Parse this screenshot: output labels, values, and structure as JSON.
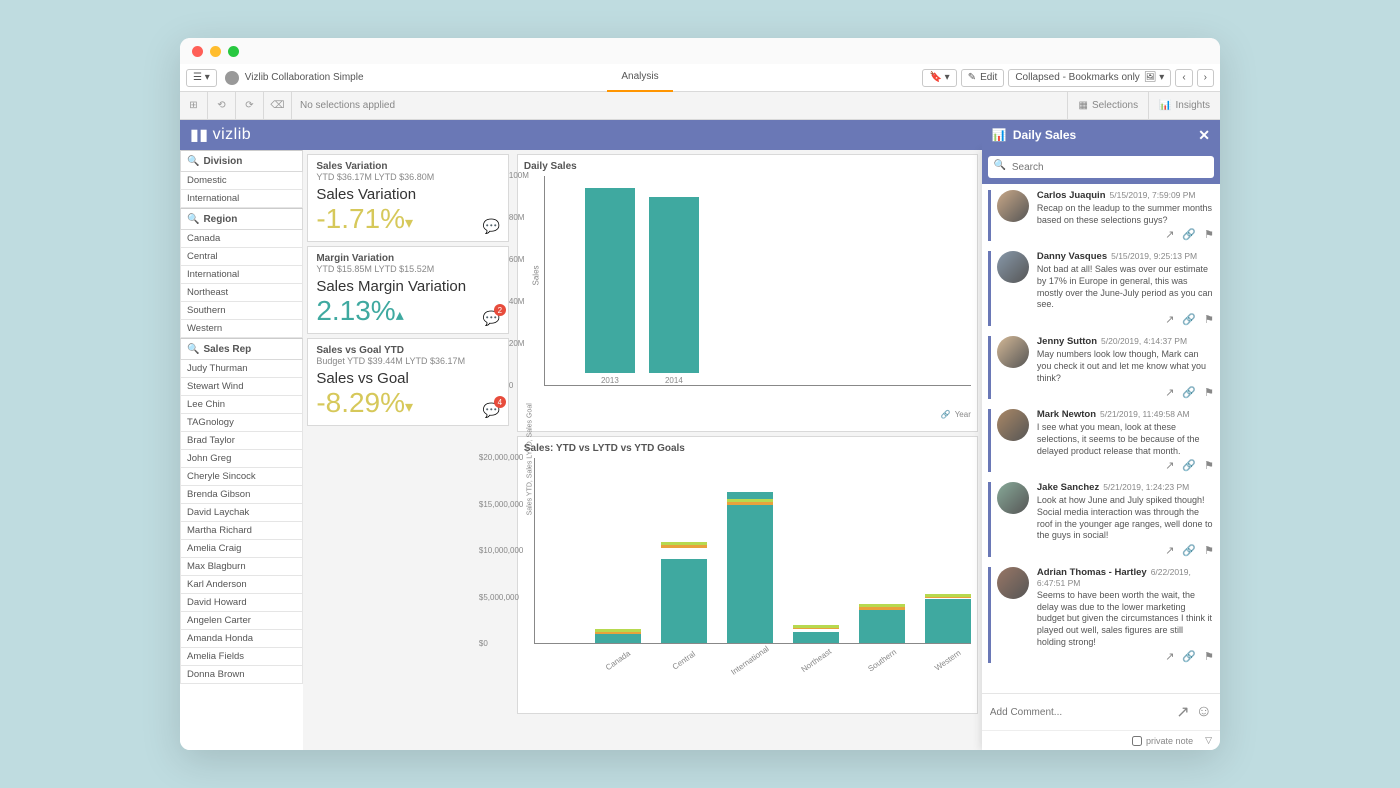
{
  "app_title": "Vizlib Collaboration Simple",
  "brand": "vizlib",
  "tabs": {
    "active": "Analysis"
  },
  "toolbar": {
    "edit": "Edit",
    "bookmarks": "Collapsed - Bookmarks only"
  },
  "selection_bar": {
    "text": "No selections applied",
    "selections_btn": "Selections",
    "insights_btn": "Insights"
  },
  "filters": {
    "division": {
      "label": "Division",
      "items": [
        "Domestic",
        "International"
      ]
    },
    "region": {
      "label": "Region",
      "items": [
        "Canada",
        "Central",
        "International",
        "Northeast",
        "Southern",
        "Western"
      ]
    },
    "salesrep": {
      "label": "Sales Rep",
      "items": [
        "Judy Thurman",
        "Stewart Wind",
        "Lee Chin",
        "TAGnology",
        "Brad Taylor",
        "John Greg",
        "Cheryle Sincock",
        "Brenda Gibson",
        "David Laychak",
        "Martha Richard",
        "Amelia Craig",
        "Max Blagburn",
        "Karl Anderson",
        "David Howard",
        "Angelen Carter",
        "Amanda Honda",
        "Amelia Fields",
        "Donna Brown"
      ]
    }
  },
  "kpis": {
    "salesvar": {
      "title": "Sales Variation",
      "sub": "YTD $36.17M LYTD $36.80M",
      "label": "Sales Variation",
      "value": "-1.71%"
    },
    "marginvar": {
      "title": "Margin Variation",
      "sub": "YTD $15.85M LYTD $15.52M",
      "label": "Sales Margin Variation",
      "value": "2.13%",
      "badge": "2"
    },
    "salesgoal": {
      "title": "Sales vs Goal YTD",
      "sub": "Budget YTD $39.44M LYTD $36.17M",
      "label": "Sales vs Goal",
      "value": "-8.29%",
      "badge": "4"
    }
  },
  "daily_chart": {
    "title": "Daily Sales",
    "xaxis": "Year"
  },
  "ytd_chart": {
    "title": "Sales: YTD vs LYTD vs YTD Goals",
    "yaxis": "Sales YTD, Sales LYTD, Sales Goal"
  },
  "comments_panel": {
    "title": "Daily Sales",
    "search_placeholder": "Search",
    "add_placeholder": "Add Comment...",
    "private_label": "private note"
  },
  "comments": [
    {
      "name": "Carlos Juaquin",
      "time": "5/15/2019, 7:59:09 PM",
      "text": "Recap on the leadup to the summer months based on these selections guys?"
    },
    {
      "name": "Danny Vasques",
      "time": "5/15/2019, 9:25:13 PM",
      "text": "Not bad at all! Sales was over our estimate by 17% in Europe in general, this was mostly over the June-July period as you can see."
    },
    {
      "name": "Jenny Sutton",
      "time": "5/20/2019, 4:14:37 PM",
      "text": "May numbers look low though, Mark can you check it out and let me know what you think?"
    },
    {
      "name": "Mark Newton",
      "time": "5/21/2019, 11:49:58 AM",
      "text": "I see what you mean, look at these selections, it seems to be because of the delayed product release that month."
    },
    {
      "name": "Jake Sanchez",
      "time": "5/21/2019, 1:24:23 PM",
      "text": "Look at how June and July spiked though! Social media interaction was through the roof in the younger age ranges, well done to the guys in social!"
    },
    {
      "name": "Adrian Thomas - Hartley",
      "time": "6/22/2019, 6:47:51 PM",
      "text": "Seems to have been worth the wait, the delay was due to the lower marketing budget but given the circumstances I think it played out well, sales figures are still holding strong!"
    }
  ],
  "chart_data": [
    {
      "type": "bar",
      "title": "Daily Sales",
      "categories": [
        "2013",
        "2014"
      ],
      "values": [
        88000000,
        84000000
      ],
      "ylabel": "Sales",
      "ylim": [
        0,
        100000000
      ],
      "yticks": [
        "0",
        "20M",
        "40M",
        "60M",
        "80M",
        "100M"
      ]
    },
    {
      "type": "bar",
      "title": "Sales: YTD vs LYTD vs YTD Goals",
      "categories": [
        "Canada",
        "Central",
        "International",
        "Northeast",
        "Southern",
        "Western"
      ],
      "series": [
        {
          "name": "Sales YTD",
          "values": [
            1100000,
            9000000,
            16200000,
            1200000,
            3800000,
            4700000
          ]
        },
        {
          "name": "Sales LYTD",
          "values": [
            1000000,
            10200000,
            14800000,
            1500000,
            3600000,
            4800000
          ],
          "color": "#e8a23c"
        },
        {
          "name": "Sales Goal",
          "values": [
            1200000,
            10500000,
            15200000,
            1600000,
            3900000,
            5000000
          ],
          "color": "#b7d94f"
        }
      ],
      "ylabel": "Sales YTD, Sales LYTD, Sales Goal",
      "ylim": [
        0,
        20000000
      ],
      "yticks": [
        "$0",
        "$5,000,000",
        "$10,000,000",
        "$15,000,000",
        "$20,000,000"
      ]
    }
  ]
}
